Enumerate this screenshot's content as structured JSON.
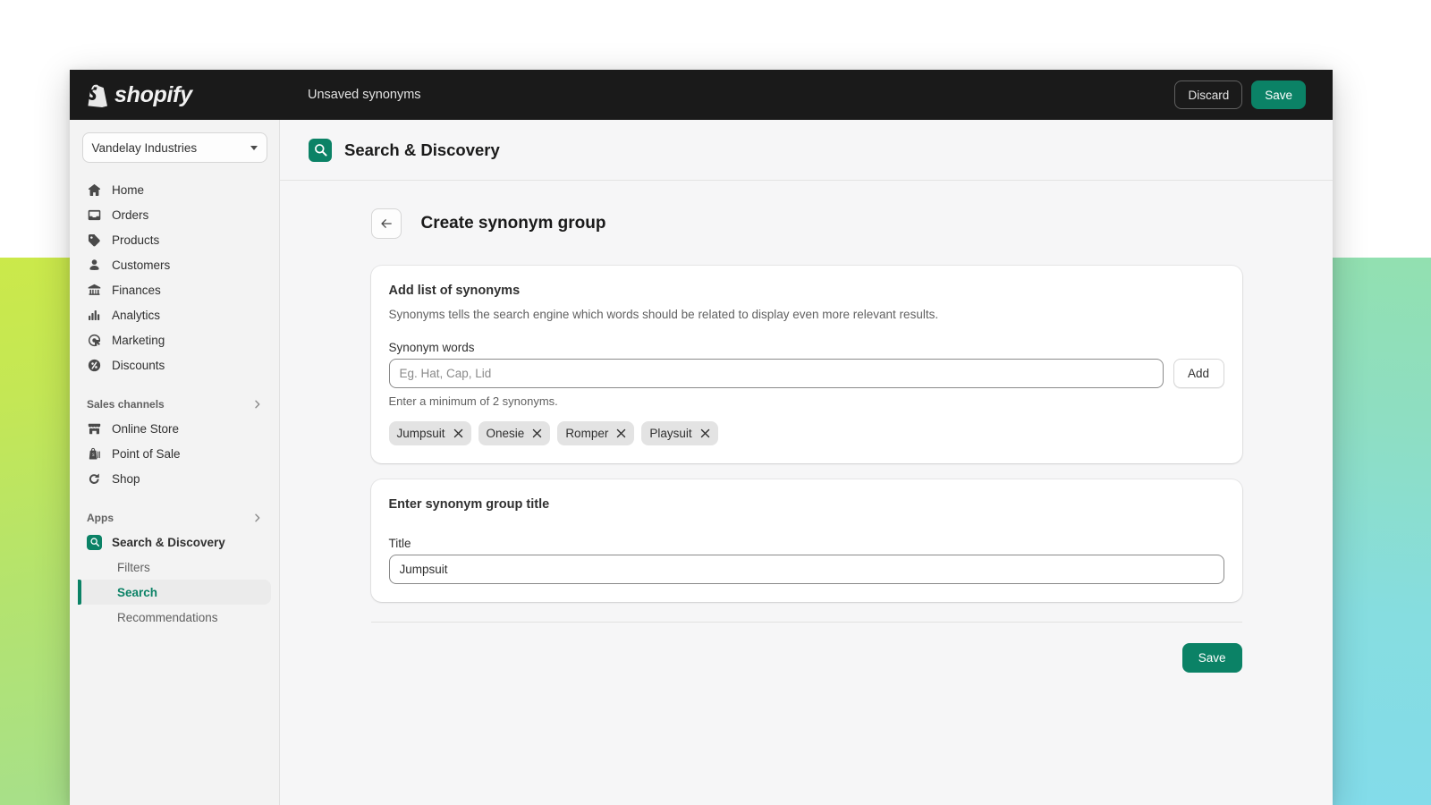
{
  "topbar": {
    "logo_text": "shopify",
    "logo_icon": "shopify-bag-icon",
    "title": "Unsaved synonyms",
    "discard_label": "Discard",
    "save_label": "Save"
  },
  "sidebar": {
    "store": {
      "name": "Vandelay Industries",
      "caret_icon": "chevron-down-icon"
    },
    "items": [
      {
        "label": "Home",
        "icon": "home-icon"
      },
      {
        "label": "Orders",
        "icon": "orders-inbox-icon"
      },
      {
        "label": "Products",
        "icon": "product-tag-icon"
      },
      {
        "label": "Customers",
        "icon": "person-icon"
      },
      {
        "label": "Finances",
        "icon": "bank-icon"
      },
      {
        "label": "Analytics",
        "icon": "bar-chart-icon"
      },
      {
        "label": "Marketing",
        "icon": "megaphone-target-icon"
      },
      {
        "label": "Discounts",
        "icon": "discount-percent-icon"
      }
    ],
    "sales_channels": {
      "title": "Sales channels",
      "chevron_icon": "chevron-right-icon",
      "items": [
        {
          "label": "Online Store",
          "icon": "storefront-icon"
        },
        {
          "label": "Point of Sale",
          "icon": "point-of-sale-icon"
        },
        {
          "label": "Shop",
          "icon": "shop-bag-icon"
        }
      ]
    },
    "apps": {
      "title": "Apps",
      "chevron_icon": "chevron-right-icon",
      "items": [
        {
          "label": "Search & Discovery",
          "icon": "search-discovery-app-icon"
        }
      ],
      "sub_items": [
        {
          "label": "Filters",
          "active": false
        },
        {
          "label": "Search",
          "active": true
        },
        {
          "label": "Recommendations",
          "active": false
        }
      ]
    }
  },
  "app_header": {
    "icon": "search-discovery-app-icon",
    "title": "Search & Discovery"
  },
  "page": {
    "back_icon": "arrow-left-icon",
    "title": "Create synonym group"
  },
  "synonyms_card": {
    "title": "Add list of synonyms",
    "description": "Synonyms tells the search engine which words should be related to display even more relevant results.",
    "field_label": "Synonym words",
    "input_value": "",
    "input_placeholder": "Eg. Hat, Cap, Lid",
    "add_label": "Add",
    "help_text": "Enter a minimum of 2 synonyms.",
    "tags": [
      {
        "label": "Jumpsuit",
        "remove_icon": "close-x-icon"
      },
      {
        "label": "Onesie",
        "remove_icon": "close-x-icon"
      },
      {
        "label": "Romper",
        "remove_icon": "close-x-icon"
      },
      {
        "label": "Playsuit",
        "remove_icon": "close-x-icon"
      }
    ]
  },
  "title_card": {
    "title": "Enter synonym group title",
    "field_label": "Title",
    "input_value": "Jumpsuit",
    "input_placeholder": ""
  },
  "footer": {
    "save_label": "Save"
  },
  "colors": {
    "accent_green": "#0b8266",
    "topbar_dark": "#1a1a1a",
    "page_bg": "#f6f6f7",
    "sidebar_bg": "#f3f3f3",
    "card_bg": "#ffffff",
    "tag_bg": "#e3e3e3",
    "gradient_left": "#cbe94a",
    "gradient_right": "#83dcea"
  }
}
